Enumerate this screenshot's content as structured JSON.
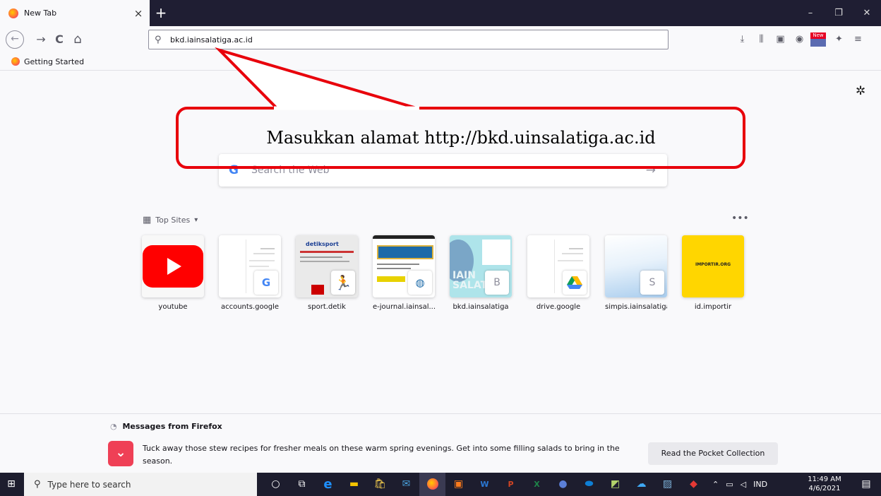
{
  "browser": {
    "tab": {
      "title": "New Tab",
      "close": "×"
    },
    "new_tab": "+",
    "window": {
      "minimize": "–",
      "maximize": "❐",
      "close": "✕"
    },
    "nav": {
      "back": "←",
      "forward": "→",
      "reload": "C",
      "home": "⌂"
    },
    "url": "bkd.iainsalatiga.ac.id",
    "toolbar_icons": [
      "download-icon",
      "library-icon",
      "sidebar-icon",
      "account-icon",
      "new-badge-icon",
      "extensions-icon",
      "menu-icon"
    ],
    "new_badge": "New"
  },
  "bookmarks": [
    {
      "label": "Getting Started"
    }
  ],
  "annotation": {
    "text": "Masukkan alamat http://bkd.uinsalatiga.ac.id",
    "color": "#e8000b"
  },
  "search": {
    "placeholder": "Search the Web",
    "engine": "G"
  },
  "top_sites": {
    "header": "Top Sites",
    "more": "•••",
    "sites": [
      {
        "label": "youtube"
      },
      {
        "label": "accounts.google"
      },
      {
        "label": "sport.detik"
      },
      {
        "label": "e-journal.iainsal..."
      },
      {
        "label": "bkd.iainsalatiga"
      },
      {
        "label": "drive.google"
      },
      {
        "label": "simpis.iainsalatiga"
      },
      {
        "label": "id.importir"
      }
    ],
    "badges": {
      "google": "G",
      "bkd": "B",
      "simpis": "S"
    },
    "thumb_texts": {
      "detik": "detiksport",
      "importir": "IMPORTIR.ORG",
      "bkd": "IAIN SALAT"
    }
  },
  "messages": {
    "header": "Messages from Firefox",
    "text": "Tuck away those stew recipes for fresher meals on these warm spring evenings. Get into some filling salads to bring in the season.",
    "button": "Read the Pocket Collection"
  },
  "taskbar": {
    "search_placeholder": "Type here to search",
    "tray": {
      "lang": "IND"
    },
    "time": "11:49 AM",
    "date": "4/6/2021"
  }
}
